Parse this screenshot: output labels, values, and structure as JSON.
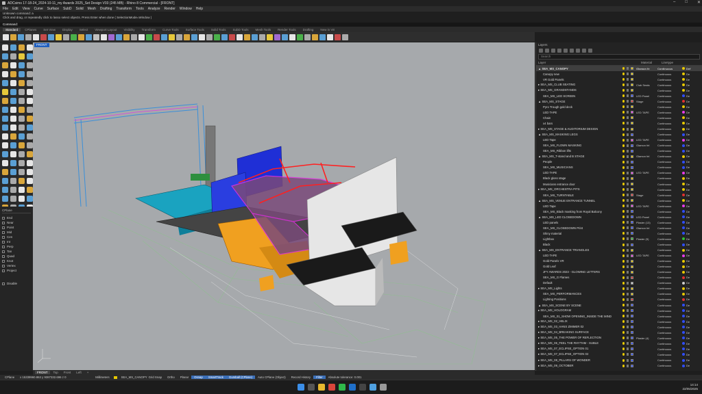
{
  "app": {
    "title": "ADCsims 17-18-24_2024-10-11_my Awards 2025_Set Design V03 (245 MB) - Rhino 8 Commercial - [FRONT]"
  },
  "menu": [
    "File",
    "Edit",
    "View",
    "Curve",
    "Surface",
    "SubD",
    "Solid",
    "Mesh",
    "Drafting",
    "Transform",
    "Tools",
    "Analyze",
    "Render",
    "Window",
    "Help"
  ],
  "command_history": [
    "Unknown command: a",
    "Click and drag, or repeatedly click to lasso select objects. Press Enter when done ( SelectionMode=Window )"
  ],
  "command_prompt": "Command:",
  "toolbar_tabs": [
    "Standard",
    "CPlanes",
    "Set View",
    "Display",
    "Select",
    "Viewport Layout",
    "Visibility",
    "Transform",
    "Curve Tools",
    "Surface Tools",
    "Solid Tools",
    "SubD Tools",
    "Mesh Tools",
    "Render Tools",
    "Drafting",
    "New in V8"
  ],
  "viewport": {
    "label": "FRONT"
  },
  "viewport_tabs": [
    "FRONT",
    "Top",
    "Front",
    "Left",
    "+"
  ],
  "osnap": {
    "header": "CPlane",
    "items": [
      "End",
      "Near",
      "Point",
      "Mid",
      "Cen",
      "Int",
      "Perp",
      "Tan",
      "Quad",
      "Knot",
      "Vertex",
      "Project",
      "Disable"
    ]
  },
  "layers_panel": {
    "title": "Layers",
    "search_placeholder": "Search",
    "columns": [
      "Layer",
      "Material",
      "Linetype"
    ],
    "rows": [
      {
        "name": "▲ SEA_MS_CANOPY",
        "material": "Glamon fe",
        "linetype": "Continuous",
        "color": "#e8c900",
        "print": "Def",
        "sel": true
      },
      {
        "name": "Canopy new",
        "material": "",
        "linetype": "Continuous",
        "color": "#e8c900",
        "print": "De"
      },
      {
        "name": "VR Gold Panels",
        "material": "",
        "linetype": "Continuous",
        "color": "#e8c900",
        "print": "De"
      },
      {
        "name": "▸ SEA_MS_CLUB SEATING",
        "material": "Club Seats",
        "linetype": "Continuous",
        "color": "#e8c900",
        "print": "De"
      },
      {
        "name": "▸ SEA_MS_GRANDSTANDS",
        "material": "",
        "linetype": "Continuous",
        "color": "#e8c900",
        "print": "De"
      },
      {
        "name": "SEA_MS_LED SCREEN",
        "material": "LED Panel",
        "linetype": "Continuous",
        "color": "#2f4dff",
        "print": "De"
      },
      {
        "name": "▲ SEA_MS_STAGE",
        "material": "Stage",
        "linetype": "Continuous",
        "color": "#e03030",
        "print": "De"
      },
      {
        "name": "Pyro Trough gold deck",
        "material": "",
        "linetype": "Continuous",
        "color": "#e8c900",
        "print": "De"
      },
      {
        "name": "LED TAPE",
        "material": "LED TAPE",
        "linetype": "Continuous",
        "color": "#e83be8",
        "print": "De"
      },
      {
        "name": "Chain",
        "material": "",
        "linetype": "Continuous",
        "color": "#e8c900",
        "print": "De"
      },
      {
        "name": "x4 bars",
        "material": "",
        "linetype": "Continuous",
        "color": "#e8c900",
        "print": "De"
      },
      {
        "name": "▸ SEA_MS_STAGE & AUDITORIUM DESIGN",
        "material": "",
        "linetype": "Continuous",
        "color": "#e8c900",
        "print": "De"
      },
      {
        "name": "▲ SEA_MS_MASKING LEGS",
        "material": "",
        "linetype": "Continuous",
        "color": "#2f4dff",
        "print": "De"
      },
      {
        "name": "LED Tape",
        "material": "LED TAPE",
        "linetype": "Continuous",
        "color": "#e83be8",
        "print": "De"
      },
      {
        "name": "SEA_MS_FLOWN MASKING",
        "material": "Glamon fel",
        "linetype": "Continuous",
        "color": "#2f4dff",
        "print": "De"
      },
      {
        "name": "SEA_MS_Ribbon lifts",
        "material": "",
        "linetype": "Continuous",
        "color": "#2f4dff",
        "print": "De"
      },
      {
        "name": "▲ SEA_MS_T-stand and B STAGE",
        "material": "Glamon fel",
        "linetype": "Continuous",
        "color": "#e8c900",
        "print": "De"
      },
      {
        "name": "People",
        "material": "",
        "linetype": "Continuous",
        "color": "#2f4dff",
        "print": "De"
      },
      {
        "name": "SEA_MS_MUSICIANS",
        "material": "",
        "linetype": "Continuous",
        "color": "#2f4dff",
        "print": "De"
      },
      {
        "name": "LED TAPE",
        "material": "LED TAPE",
        "linetype": "Continuous",
        "color": "#e83be8",
        "print": "De"
      },
      {
        "name": "Black gloss stage",
        "material": "",
        "linetype": "Continuous",
        "color": "#e8c900",
        "print": "De"
      },
      {
        "name": "Musicians entrance door",
        "material": "",
        "linetype": "Continuous",
        "color": "#e8c900",
        "print": "De"
      },
      {
        "name": "▸ SEA_MS_ORCHESTRA PITS",
        "material": "",
        "linetype": "Continuous",
        "color": "#e8c900",
        "print": "De"
      },
      {
        "name": "SEA_MS_TURNTABLE",
        "material": "Stage",
        "linetype": "Continuous",
        "color": "#e03030",
        "print": "De"
      },
      {
        "name": "▲ SEA_MS_VENUE ENTRANCE TUNNEL",
        "material": "",
        "linetype": "Continuous",
        "color": "#e8c900",
        "print": "De"
      },
      {
        "name": "LED Tape",
        "material": "LED TAPE",
        "linetype": "Continuous",
        "color": "#e83be8",
        "print": "De"
      },
      {
        "name": "SEA_MS_Black masking from Royal Balcony",
        "material": "",
        "linetype": "Continuous",
        "color": "#2f4dff",
        "print": "De"
      },
      {
        "name": "▲ SEA_MS_LED CLOSEDOWN",
        "material": "LED Panel",
        "linetype": "Continuous",
        "color": "#2f4dff",
        "print": "De"
      },
      {
        "name": "LED panels",
        "material": "Plaster (13)",
        "linetype": "Continuous",
        "color": "#2f4dff",
        "print": "De"
      },
      {
        "name": "SEA_MS_CLOSEDOWN Print",
        "material": "Glamon fel",
        "linetype": "Continuous",
        "color": "#2f4dff",
        "print": "De"
      },
      {
        "name": "Shiny material",
        "material": "",
        "linetype": "Continuous",
        "color": "#2f4dff",
        "print": "De"
      },
      {
        "name": "Lightbox",
        "material": "Plaster (9)",
        "linetype": "Continuous",
        "color": "#30c030",
        "print": "De"
      },
      {
        "name": "Black",
        "material": "",
        "linetype": "Continuous",
        "color": "#2f4dff",
        "print": "De"
      },
      {
        "name": "▲ SEA_MS_ENTRANCE TRIANGLES",
        "material": "",
        "linetype": "Continuous",
        "color": "#e8c900",
        "print": "De"
      },
      {
        "name": "LED TAPE",
        "material": "LED TAPE",
        "linetype": "Continuous",
        "color": "#e83be8",
        "print": "De"
      },
      {
        "name": "Gold Panels VR",
        "material": "",
        "linetype": "Continuous",
        "color": "#e8c900",
        "print": "De"
      },
      {
        "name": "Gold Leaf",
        "material": "",
        "linetype": "Continuous",
        "color": "#e8c900",
        "print": "De"
      },
      {
        "name": "JFY AWARDS 2023 - GLOWING LETTERS",
        "material": "",
        "linetype": "Continuous",
        "color": "#e8c900",
        "print": "De"
      },
      {
        "name": "SEA_MS_G Flames",
        "material": "",
        "linetype": "Continuous",
        "color": "#e03030",
        "print": "De"
      },
      {
        "name": "Default",
        "material": "",
        "linetype": "Continuous",
        "color": "#cccccc",
        "print": "De"
      },
      {
        "name": "▸ SEA_MS_Lights",
        "material": "",
        "linetype": "Continuous",
        "color": "#e8c900",
        "print": "De"
      },
      {
        "name": "SEA_MS_PERFORMANCES",
        "material": "",
        "linetype": "Continuous",
        "color": "#e8c900",
        "print": "De"
      },
      {
        "name": "Lighting Positions",
        "material": "",
        "linetype": "Continuous",
        "color": "#e03030",
        "print": "De"
      },
      {
        "name": "▲ SEA_MS_SCENE BY SCENE",
        "material": "",
        "linetype": "Continuous",
        "color": "#2f4dff",
        "print": "De"
      },
      {
        "name": "▸ SEA_MS_HOLOGRAM",
        "material": "",
        "linetype": "Continuous",
        "color": "#2f4dff",
        "print": "De"
      },
      {
        "name": "SEA_MS_01_SHOW OPENING_INSIDE THE MIND",
        "material": "",
        "linetype": "Continuous",
        "color": "#2f4dff",
        "print": "De"
      },
      {
        "name": "▸ SEA_MS_02_HELIX",
        "material": "",
        "linetype": "Continuous",
        "color": "#2f4dff",
        "print": "De"
      },
      {
        "name": "▸ SEA_MS_03_HANS ZIMMER 02",
        "material": "",
        "linetype": "Continuous",
        "color": "#2f4dff",
        "print": "De"
      },
      {
        "name": "▸ SEA_MS_04_BREAKING SURFACE",
        "material": "",
        "linetype": "Continuous",
        "color": "#2f4dff",
        "print": "De"
      },
      {
        "name": "▸ SEA_MS_05_THE POWER OF REFLECTION",
        "material": "Plaster (4)",
        "linetype": "Continuous",
        "color": "#2f4dff",
        "print": "De"
      },
      {
        "name": "▸ SEA_MS_06_FEEL THE RHYTHM - SUBLE",
        "material": "",
        "linetype": "Continuous",
        "color": "#2f4dff",
        "print": "De"
      },
      {
        "name": "▸ SEA_MS_07_ECLIPSE_OPTION 01",
        "material": "",
        "linetype": "Continuous",
        "color": "#2f4dff",
        "print": "De"
      },
      {
        "name": "▸ SEA_MS_07_ECLIPSE_OPTION 02",
        "material": "",
        "linetype": "Continuous",
        "color": "#2f4dff",
        "print": "De"
      },
      {
        "name": "▸ SEA_MS_08_PILLARS OF WONDER",
        "material": "",
        "linetype": "Continuous",
        "color": "#2f4dff",
        "print": "De"
      },
      {
        "name": "▸ SEA_MS_09_OCTOBER",
        "material": "",
        "linetype": "Continuous",
        "color": "#2f4dff",
        "print": "De"
      }
    ]
  },
  "status_bar": {
    "cplane": "CPlane",
    "coords": "x 15339960.863  y 9387332.696  z 0",
    "units": "Millimeters",
    "layer": "SEA_MS_CANOPY",
    "items": [
      {
        "label": "Grid Snap",
        "on": false
      },
      {
        "label": "Ortho",
        "on": false
      },
      {
        "label": "Planar",
        "on": false
      },
      {
        "label": "Osnap",
        "on": true
      },
      {
        "label": "SmartTrack",
        "on": true
      },
      {
        "label": "Gumball (CPlane)",
        "on": true
      },
      {
        "label": "Auto CPlane (Object)",
        "on": false
      },
      {
        "label": "Record History",
        "on": false
      },
      {
        "label": "Filter",
        "on": true
      }
    ],
    "tolerance": "Absolute tolerance: 0.001"
  },
  "taskbar": {
    "time": "14:14",
    "date": "22/05/2025"
  },
  "colors": {
    "viewport_bg": "#a6a9ac",
    "accent": "#3b6fb8"
  }
}
